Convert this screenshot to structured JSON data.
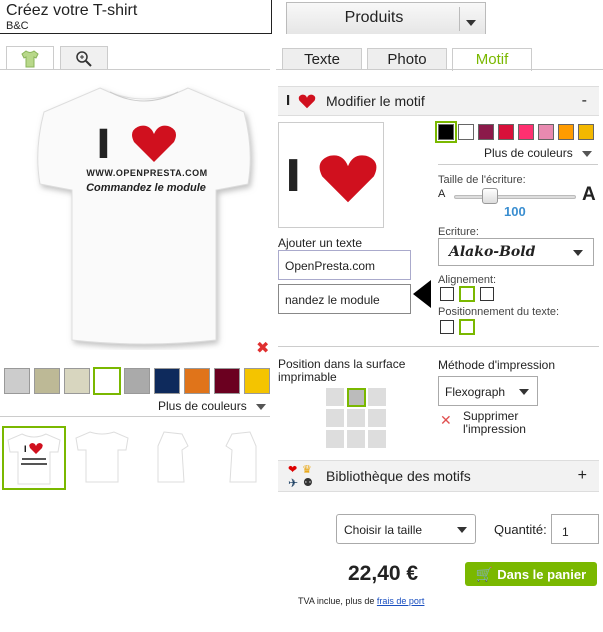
{
  "header": {
    "title": "Créez votre T-shirt",
    "subtitle": "B&C",
    "products_tab": "Produits"
  },
  "left_tabs": [
    {
      "icon": "tshirt-icon"
    },
    {
      "icon": "zoom-icon"
    }
  ],
  "right_tabs": [
    {
      "label": "Texte"
    },
    {
      "label": "Photo"
    },
    {
      "label": "Motif"
    }
  ],
  "shirt_print": {
    "word": "I",
    "line1": "WWW.OPENPRESTA.COM",
    "line2": "Commandez le module"
  },
  "product_colors": {
    "swatches": [
      "#cccccc",
      "#bdb996",
      "#d8d6bf",
      "#ffffff",
      "#aaaaaa",
      "#0e2a5c",
      "#e0741a",
      "#6b0020",
      "#f4c400"
    ],
    "more_label": "Plus de couleurs"
  },
  "motif_section": {
    "header": "Modifier le motif",
    "toggle": "-",
    "add_text_label": "Ajouter un texte",
    "text1": "OpenPresta.com",
    "text2": "nandez le module",
    "colors": [
      "#000000",
      "#ffffff",
      "#8b1a4a",
      "#d8103a",
      "#ff3070",
      "#e88ab0",
      "#ff9c00",
      "#f3b800"
    ],
    "more_colors": "Plus de couleurs",
    "size_label": "Taille de l'écriture:",
    "size_small": "A",
    "size_big": "A",
    "size_value": "100",
    "font_label": "Ecriture:",
    "font_value": "Alako-Bold",
    "align_label": "Alignement:",
    "pos_text_label": "Positionnement du texte:"
  },
  "position": {
    "label": "Position dans la surface imprimable"
  },
  "method": {
    "label": "Méthode d'impression",
    "value": "Flexograph",
    "delete_label": "Supprimer l'impression"
  },
  "library": {
    "header": "Bibliothèque des motifs",
    "toggle": "+"
  },
  "order": {
    "size_placeholder": "Choisir la taille",
    "qty_label": "Quantité:",
    "qty_value": "1",
    "price": "22,40 €",
    "cart_button": "Dans le panier",
    "vat_text": "TVA inclue, plus de",
    "shipping_link": "frais de port"
  }
}
